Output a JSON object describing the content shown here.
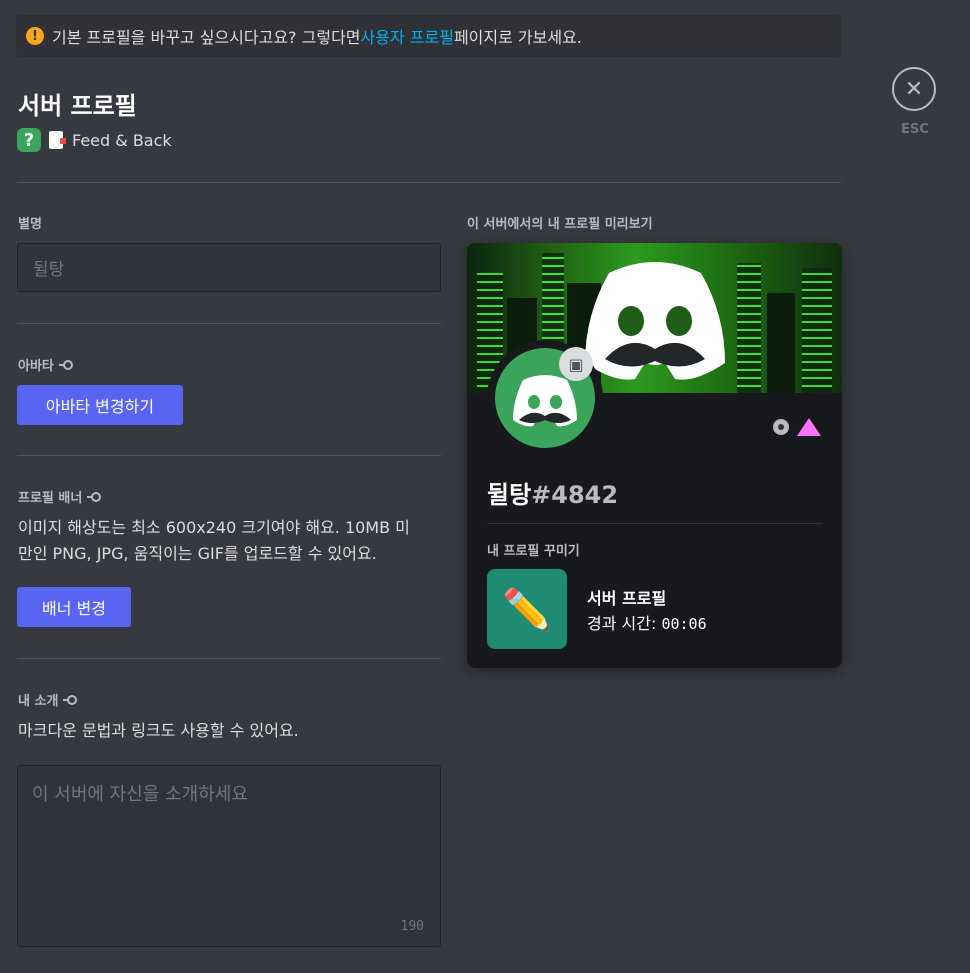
{
  "notice": {
    "before": "기본 프로필을 바꾸고 싶으시다고요? 그렇다면 ",
    "link": "사용자 프로필",
    "after": " 페이지로 가보세요."
  },
  "header": {
    "title": "서버 프로필",
    "server_name": "Feed & Back"
  },
  "close": {
    "label": "ESC"
  },
  "nickname": {
    "label": "별명",
    "placeholder": "뒬탕"
  },
  "avatar_section": {
    "label": "아바타",
    "button": "아바타 변경하기"
  },
  "banner_section": {
    "label": "프로필 배너",
    "desc_line1": "이미지 해상도는 최소 600x240 크기여야 해요. 10MB 미",
    "desc_line2": "만인 PNG, JPG, 움직이는 GIF를 업로드할 수 있어요.",
    "button": "배너 변경"
  },
  "bio_section": {
    "label": "내 소개",
    "desc": "마크다운 문법과 링크도 사용할 수 있어요.",
    "placeholder": "이 서버에 자신을 소개하세요",
    "remaining": "190"
  },
  "preview": {
    "label": "이 서버에서의 내 프로필 미리보기",
    "username": "뒬탕",
    "discriminator": "#4842",
    "section_label": "내 프로필 꾸미기",
    "activity_title": "서버 프로필",
    "activity_sub": "경과 시간: ",
    "activity_time": "00:06"
  },
  "colors": {
    "accent": "#5865f2",
    "link": "#00aff4",
    "avatar_bg": "#3ba55c",
    "warning": "#faa61a"
  }
}
